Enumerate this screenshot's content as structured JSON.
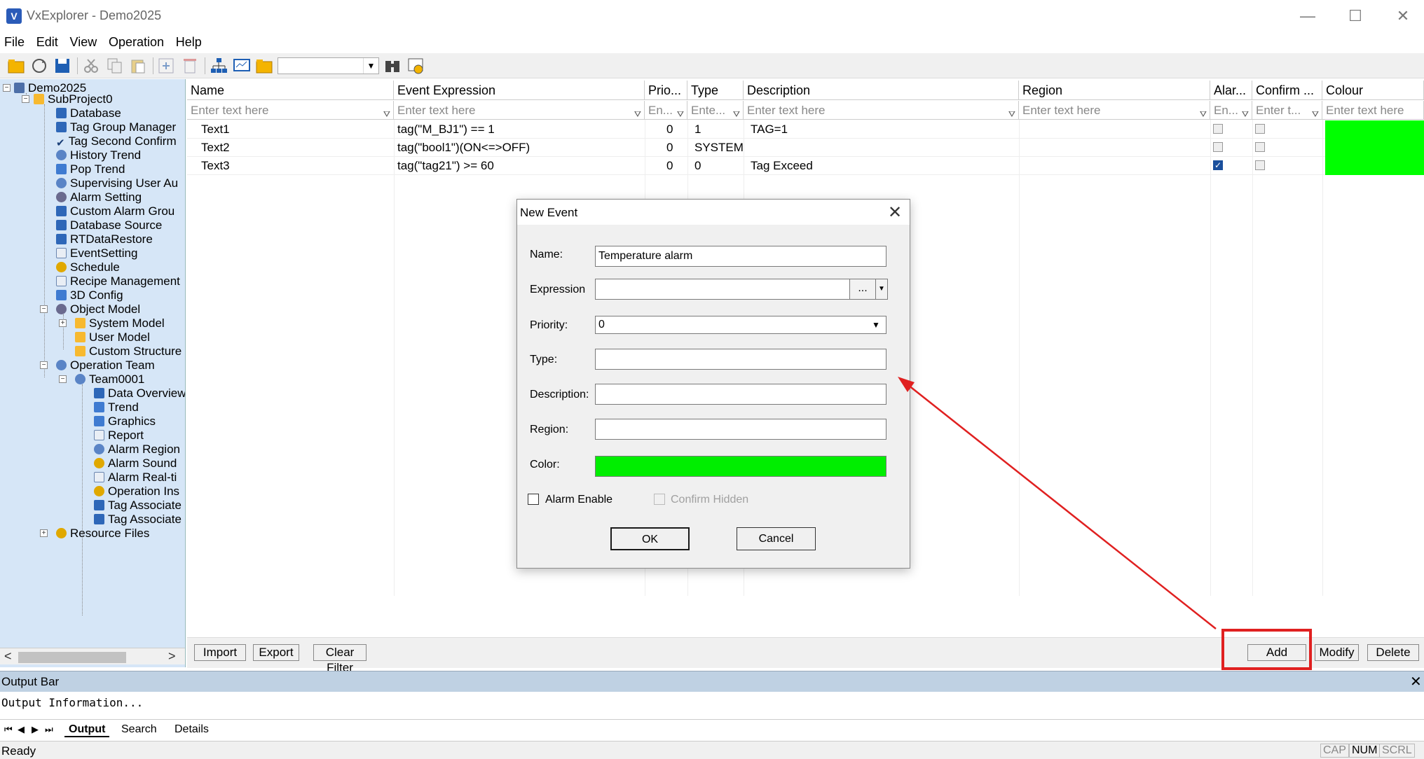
{
  "window": {
    "title": "VxExplorer - Demo2025",
    "minimize": "—",
    "maximize": "☐",
    "close": "✕"
  },
  "menu": [
    "File",
    "Edit",
    "View",
    "Operation",
    "Help"
  ],
  "tree": {
    "root": "Demo2025",
    "project": "SubProject0",
    "items": [
      "Database",
      "Tag Group Manager",
      "Tag Second Confirm",
      "History Trend",
      "Pop Trend",
      "Supervising User Au",
      "Alarm Setting",
      "Custom Alarm Grou",
      "Database Source",
      "RTDataRestore",
      "EventSetting",
      "Schedule",
      "Recipe Management",
      "3D Config"
    ],
    "object_model": "Object Model",
    "object_children": [
      "System Model",
      "User Model",
      "Custom Structure"
    ],
    "operation_team": "Operation Team",
    "team": "Team0001",
    "team_children": [
      "Data Overview",
      "Trend",
      "Graphics",
      "Report",
      "Alarm Region",
      "Alarm Sound",
      "Alarm Real-ti",
      "Operation Ins",
      "Tag Associate",
      "Tag Associate"
    ],
    "resource_files": "Resource Files"
  },
  "grid": {
    "columns": [
      "Name",
      "Event Expression",
      "Prio...",
      "Type",
      "Description",
      "Region",
      "Alar...",
      "Confirm ...",
      "Colour"
    ],
    "filters": [
      "Enter text here",
      "Enter text here",
      "En...",
      "Ente...",
      "Enter text here",
      "Enter text here",
      "En...",
      "Enter t...",
      "Enter text here"
    ],
    "rows": [
      {
        "name": "Text1",
        "expression": "tag(\"M_BJ1\") == 1",
        "priority": "0",
        "type": "1",
        "description": "TAG=1",
        "alarm": false,
        "confirm": false,
        "colour": "#00ff00"
      },
      {
        "name": "Text2",
        "expression": "tag(\"bool1\")(ON<=>OFF)",
        "priority": "0",
        "type": "SYSTEM",
        "description": "",
        "alarm": false,
        "confirm": false,
        "colour": "#00ff00"
      },
      {
        "name": "Text3",
        "expression": "tag(\"tag21\") >= 60",
        "priority": "0",
        "type": "0",
        "description": "Tag Exceed",
        "alarm": true,
        "confirm": false,
        "colour": "#00ff00"
      }
    ]
  },
  "footer": {
    "import": "Import",
    "export": "Export",
    "clear_filter": "Clear Filter",
    "add": "Add",
    "modify": "Modify",
    "delete": "Delete"
  },
  "output": {
    "title": "Output Bar",
    "close": "✕",
    "info": "Output Information...",
    "tabs": [
      "Output",
      "Search",
      "Details"
    ]
  },
  "status": {
    "ready": "Ready",
    "cap": "CAP",
    "num": "NUM",
    "scrl": "SCRL"
  },
  "dialog": {
    "title": "New Event",
    "close": "✕",
    "name_label": "Name:",
    "name_value": "Temperature alarm",
    "expression_label": "Expression",
    "expression_value": "",
    "ellipsis": "...",
    "priority_label": "Priority:",
    "priority_value": "0",
    "type_label": "Type:",
    "description_label": "Description:",
    "region_label": "Region:",
    "color_label": "Color:",
    "color_value": "#00ee00",
    "alarm_enable": "Alarm Enable",
    "confirm_hidden": "Confirm Hidden",
    "ok": "OK",
    "cancel": "Cancel"
  },
  "annotation_color": "#e02020"
}
